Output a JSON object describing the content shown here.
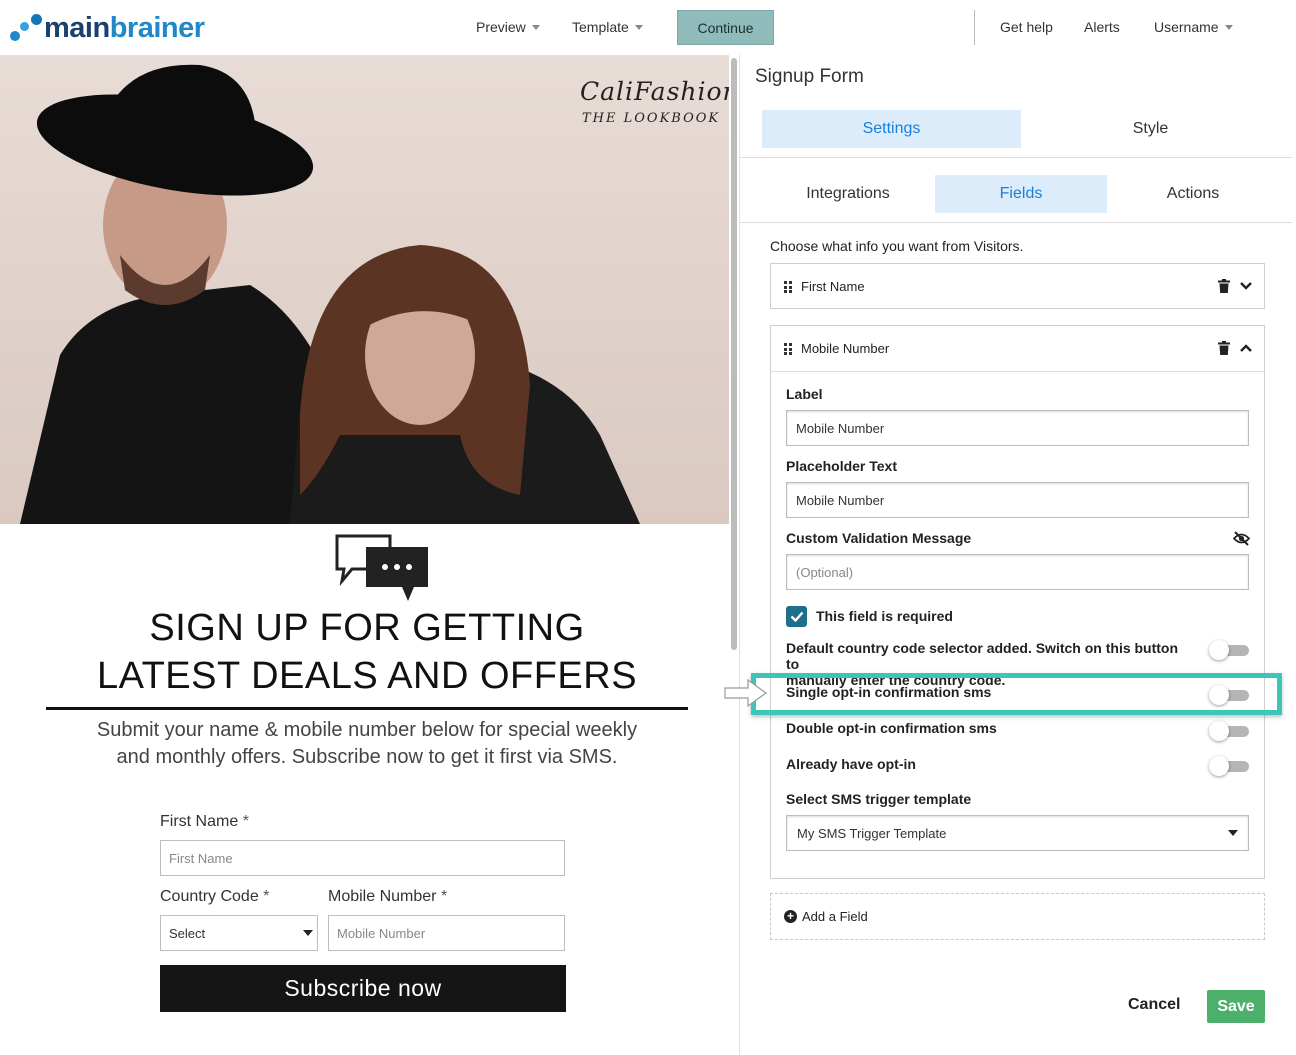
{
  "brand": {
    "logo_main": "main",
    "logo_accent": "brainer"
  },
  "nav": {
    "preview": "Preview",
    "template": "Template",
    "continue": "Continue",
    "help": "Get help",
    "alerts": "Alerts",
    "username": "Username"
  },
  "preview": {
    "brand_title": "CaliFashion",
    "brand_subtitle": "THE LOOKBOOK",
    "headline_1": "SIGN UP FOR GETTING",
    "headline_2": "LATEST DEALS AND OFFERS",
    "sub_1": "Submit your name & mobile number below for special weekly",
    "sub_2": "and monthly offers. Subscribe now to get it first via SMS.",
    "first_name_label": "First Name",
    "first_name_placeholder": "First Name",
    "country_code_label": "Country Code",
    "country_code_value": "Select",
    "mobile_label": "Mobile Number",
    "mobile_placeholder": "Mobile Number",
    "required_mark": "*",
    "subscribe_button": "Subscribe now"
  },
  "panel": {
    "title": "Signup Form",
    "tabs": {
      "settings": "Settings",
      "style": "Style"
    },
    "subtabs": {
      "integrations": "Integrations",
      "fields": "Fields",
      "actions": "Actions"
    },
    "choose_text": "Choose what info you want from Visitors.",
    "fields": [
      {
        "name": "First Name",
        "expanded": false
      },
      {
        "name": "Mobile Number",
        "expanded": true
      }
    ],
    "mobile_settings": {
      "label_heading": "Label",
      "label_value": "Mobile Number",
      "placeholder_heading": "Placeholder Text",
      "placeholder_value": "Mobile Number",
      "validation_heading": "Custom Validation Message",
      "validation_placeholder": "(Optional)",
      "required_label": "This field is required",
      "required_checked": true,
      "country_code_text_1": "Default country code selector added. Switch on this button to",
      "country_code_text_2": "manually enter the country code.",
      "single_optin": "Single opt-in confirmation sms",
      "double_optin": "Double opt-in confirmation sms",
      "already_optin": "Already have opt-in",
      "sms_template_heading": "Select SMS trigger template",
      "sms_template_value": "My SMS Trigger Template"
    },
    "add_field": "Add a Field",
    "cancel": "Cancel",
    "save": "Save"
  },
  "colors": {
    "brand_blue": "#1e88c9",
    "continue_bg": "#8fbcbb",
    "active_tab_bg": "#dcecfb",
    "active_tab_text": "#1a7fd6",
    "highlight": "#3cc6b7",
    "save_green": "#4caf6a",
    "checkbox": "#1d6f8a"
  },
  "icons": [
    "drag-handle-icon",
    "trash-icon",
    "chevron-down-icon",
    "chevron-up-icon",
    "eye-slash-icon",
    "checkmark-icon",
    "plus-circle-icon",
    "chat-bubbles-icon",
    "dropdown-caret-icon",
    "callout-arrow-icon"
  ]
}
